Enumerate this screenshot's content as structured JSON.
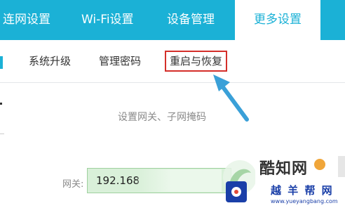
{
  "top_nav": {
    "tabs": [
      {
        "label": "连网设置"
      },
      {
        "label": "Wi-Fi设置"
      },
      {
        "label": "设备管理"
      },
      {
        "label": "更多设置"
      }
    ]
  },
  "sub_nav": {
    "tabs": [
      {
        "label": "系统升级"
      },
      {
        "label": "管理密码"
      },
      {
        "label": "重启与恢复"
      }
    ]
  },
  "section": {
    "title": "设置网关、子网掩码"
  },
  "gateway": {
    "label": "网关:",
    "value": "192.168"
  },
  "watermark": {
    "brand_top": "酷知网",
    "brand_bottom": "越 羊 帮 网",
    "url": "www.yueyangbang.com"
  },
  "colors": {
    "accent": "#1bb1d6",
    "highlight_border": "#d42f2a",
    "arrow": "#3aa0d8"
  }
}
